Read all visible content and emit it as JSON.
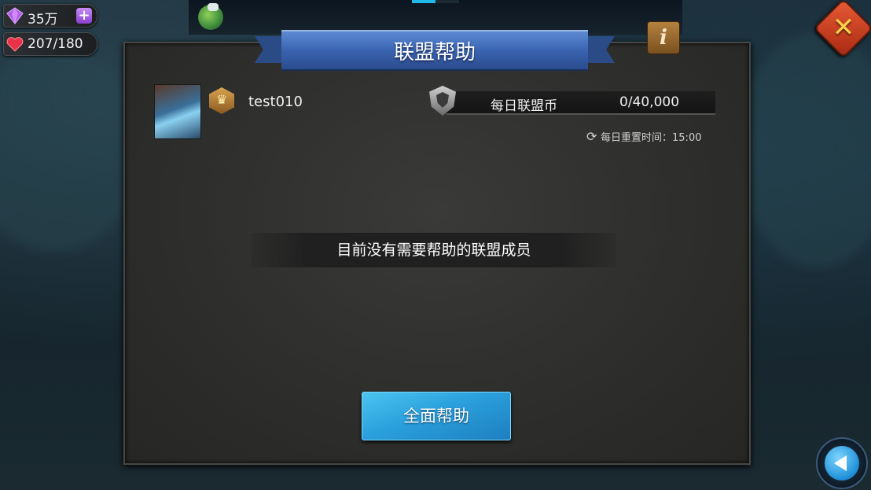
{
  "resources": {
    "gems": {
      "value": "35万",
      "icon": "gem-icon",
      "add_icon": "plus-icon"
    },
    "stamina": {
      "value": "207/180",
      "icon": "heart-icon"
    }
  },
  "panel": {
    "title": "联盟帮助",
    "member": {
      "name": "test010",
      "rank_icon": "crown-badge-icon"
    },
    "daily_coin": {
      "label": "每日联盟币",
      "value": "0/40,000",
      "icon": "shield-icon"
    },
    "reset": {
      "label": "每日重置时间：",
      "time": "15:00",
      "icon": "refresh-icon"
    },
    "empty_message": "目前没有需要帮助的联盟成员",
    "help_all_button": "全面帮助"
  },
  "buttons": {
    "info": "i",
    "close": "✕",
    "back_icon": "back-arrow-icon"
  },
  "colors": {
    "ribbon_blue": "#3a64b0",
    "button_blue": "#2aa0dc",
    "close_red": "#c8401e",
    "close_glyph_yellow": "#f7d04a"
  }
}
